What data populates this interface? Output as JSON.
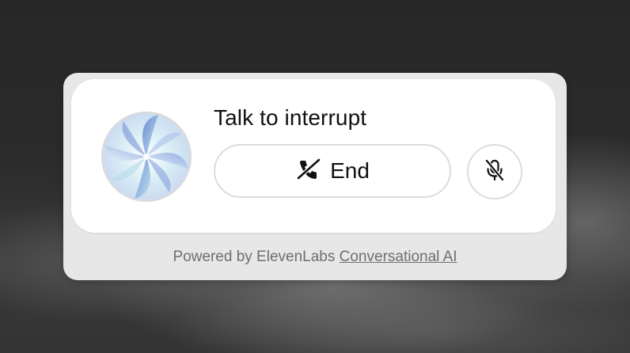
{
  "widget": {
    "status_text": "Talk to interrupt",
    "end_button": {
      "label": "End",
      "icon": "phone-off-icon"
    },
    "mute_button": {
      "icon": "mic-off-icon"
    },
    "avatar": {
      "icon": "orb-avatar"
    },
    "footer": {
      "prefix": "Powered by ElevenLabs",
      "link_text": "Conversational AI"
    }
  },
  "colors": {
    "card_background": "#ffffff",
    "shell_background": "#e7e7e7",
    "text_primary": "#111111",
    "text_muted": "#6f6f6f",
    "orb_blue": "#7b97d6",
    "orb_light": "#dff1f7"
  }
}
